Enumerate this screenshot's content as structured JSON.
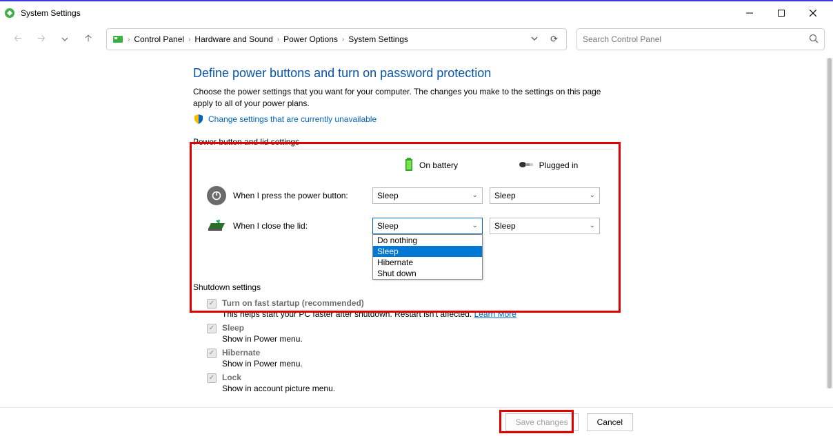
{
  "window": {
    "title": "System Settings"
  },
  "breadcrumb": {
    "items": [
      "Control Panel",
      "Hardware and Sound",
      "Power Options",
      "System Settings"
    ]
  },
  "search": {
    "placeholder": "Search Control Panel"
  },
  "page": {
    "heading": "Define power buttons and turn on password protection",
    "description": "Choose the power settings that you want for your computer. The changes you make to the settings on this page apply to all of your power plans.",
    "change_link": "Change settings that are currently unavailable"
  },
  "power_section": {
    "title": "Power button and lid settings",
    "col_battery": "On battery",
    "col_plugged": "Plugged in",
    "row_power_label": "When I press the power button:",
    "row_lid_label": "When I close the lid:",
    "power_battery_value": "Sleep",
    "power_plugged_value": "Sleep",
    "lid_battery_value": "Sleep",
    "lid_plugged_value": "Sleep",
    "dropdown_options": [
      "Do nothing",
      "Sleep",
      "Hibernate",
      "Shut down"
    ]
  },
  "shutdown_section": {
    "title": "Shutdown settings",
    "fast_label": "Turn on fast startup (recommended)",
    "fast_desc_pre": "This helps start your PC faster after shutdown. Restart isn't affected. ",
    "fast_learn": "Learn More",
    "sleep_label": "Sleep",
    "sleep_desc": "Show in Power menu.",
    "hibernate_label": "Hibernate",
    "hibernate_desc": "Show in Power menu.",
    "lock_label": "Lock",
    "lock_desc": "Show in account picture menu."
  },
  "footer": {
    "save": "Save changes",
    "cancel": "Cancel"
  }
}
